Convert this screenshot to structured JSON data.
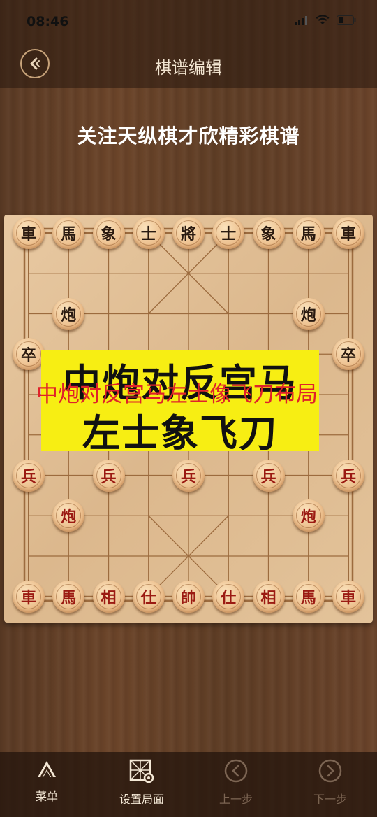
{
  "status_bar": {
    "time": "08:46"
  },
  "nav": {
    "title": "棋谱编辑",
    "back_icon": "back-arrow-icon"
  },
  "subtitle": "关注天纵棋才欣精彩棋谱",
  "overlay": {
    "line1": "中炮对反宫马",
    "line2": "左士象飞刀",
    "red_caption": "中炮对反宫马左士像飞刀布局",
    "background_color": "#f7ee13",
    "caption_color": "#e0222a"
  },
  "board": {
    "columns": 9,
    "rows": 10,
    "pieces": [
      {
        "side": "black",
        "label": "車",
        "file": 0,
        "rank": 0
      },
      {
        "side": "black",
        "label": "馬",
        "file": 1,
        "rank": 0
      },
      {
        "side": "black",
        "label": "象",
        "file": 2,
        "rank": 0
      },
      {
        "side": "black",
        "label": "士",
        "file": 3,
        "rank": 0
      },
      {
        "side": "black",
        "label": "將",
        "file": 4,
        "rank": 0
      },
      {
        "side": "black",
        "label": "士",
        "file": 5,
        "rank": 0
      },
      {
        "side": "black",
        "label": "象",
        "file": 6,
        "rank": 0
      },
      {
        "side": "black",
        "label": "馬",
        "file": 7,
        "rank": 0
      },
      {
        "side": "black",
        "label": "車",
        "file": 8,
        "rank": 0
      },
      {
        "side": "black",
        "label": "炮",
        "file": 1,
        "rank": 2
      },
      {
        "side": "black",
        "label": "炮",
        "file": 7,
        "rank": 2
      },
      {
        "side": "black",
        "label": "卒",
        "file": 0,
        "rank": 3
      },
      {
        "side": "black",
        "label": "卒",
        "file": 8,
        "rank": 3
      },
      {
        "side": "red",
        "label": "兵",
        "file": 0,
        "rank": 6
      },
      {
        "side": "red",
        "label": "兵",
        "file": 2,
        "rank": 6
      },
      {
        "side": "red",
        "label": "兵",
        "file": 4,
        "rank": 6
      },
      {
        "side": "red",
        "label": "兵",
        "file": 6,
        "rank": 6
      },
      {
        "side": "red",
        "label": "兵",
        "file": 8,
        "rank": 6
      },
      {
        "side": "red",
        "label": "炮",
        "file": 1,
        "rank": 7
      },
      {
        "side": "red",
        "label": "炮",
        "file": 7,
        "rank": 7
      },
      {
        "side": "red",
        "label": "車",
        "file": 0,
        "rank": 9
      },
      {
        "side": "red",
        "label": "馬",
        "file": 1,
        "rank": 9
      },
      {
        "side": "red",
        "label": "相",
        "file": 2,
        "rank": 9
      },
      {
        "side": "red",
        "label": "仕",
        "file": 3,
        "rank": 9
      },
      {
        "side": "red",
        "label": "帥",
        "file": 4,
        "rank": 9
      },
      {
        "side": "red",
        "label": "仕",
        "file": 5,
        "rank": 9
      },
      {
        "side": "red",
        "label": "相",
        "file": 6,
        "rank": 9
      },
      {
        "side": "red",
        "label": "馬",
        "file": 7,
        "rank": 9
      },
      {
        "side": "red",
        "label": "車",
        "file": 8,
        "rank": 9
      }
    ]
  },
  "bottom_bar": {
    "tabs": [
      {
        "label": "菜单",
        "icon": "menu-icon",
        "enabled": true
      },
      {
        "label": "设置局面",
        "icon": "setup-board-icon",
        "enabled": true
      },
      {
        "label": "上一步",
        "icon": "previous-step-icon",
        "enabled": false
      },
      {
        "label": "下一步",
        "icon": "next-step-icon",
        "enabled": false
      }
    ]
  }
}
